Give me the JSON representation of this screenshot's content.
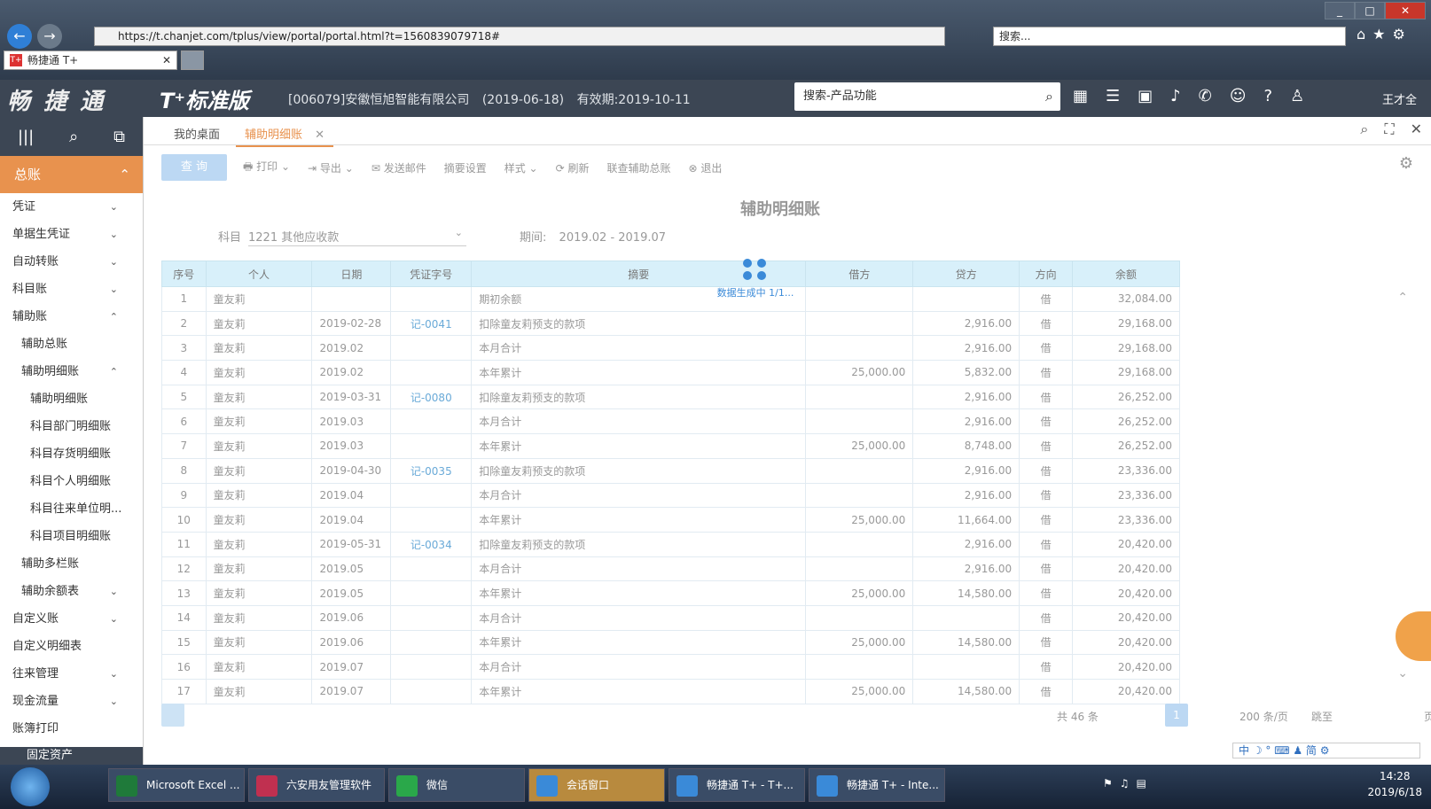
{
  "browser": {
    "url": "https://t.chanjet.com/tplus/view/portal/portal.html?t=1560839079718#",
    "search_placeholder": "搜索...",
    "tab_title": "畅捷通 T+",
    "favicon_text": "T+",
    "window_controls": [
      "_",
      "□",
      "✕"
    ]
  },
  "app": {
    "logo": "畅 捷 通",
    "product": "T⁺标准版",
    "company": "[006079]安徽恒旭智能有限公司",
    "date": "(2019-06-18)",
    "expiry": "有效期:2019-10-11",
    "search_placeholder": "搜索-产品功能",
    "user": "王才全"
  },
  "sidebar": {
    "main": "总账",
    "items": [
      {
        "label": "凭证",
        "chev": "⌄"
      },
      {
        "label": "单据生凭证",
        "chev": "⌄"
      },
      {
        "label": "自动转账",
        "chev": "⌄"
      },
      {
        "label": "科目账",
        "chev": "⌄"
      },
      {
        "label": "辅助账",
        "chev": "⌃"
      },
      {
        "label": "辅助总账",
        "chev": ""
      },
      {
        "label": "辅助明细账",
        "chev": "⌃"
      },
      {
        "label": "辅助明细账",
        "chev": ""
      },
      {
        "label": "科目部门明细账",
        "chev": ""
      },
      {
        "label": "科目存货明细账",
        "chev": ""
      },
      {
        "label": "科目个人明细账",
        "chev": ""
      },
      {
        "label": "科目往来单位明...",
        "chev": ""
      },
      {
        "label": "科目项目明细账",
        "chev": ""
      },
      {
        "label": "辅助多栏账",
        "chev": ""
      },
      {
        "label": "辅助余额表",
        "chev": "⌄"
      },
      {
        "label": "自定义账",
        "chev": "⌄"
      },
      {
        "label": "自定义明细表",
        "chev": ""
      },
      {
        "label": "往来管理",
        "chev": "⌄"
      },
      {
        "label": "现金流量",
        "chev": "⌄"
      },
      {
        "label": "账簿打印",
        "chev": ""
      }
    ],
    "bottom": "固定资产"
  },
  "tabs": {
    "desk": "我的桌面",
    "active": "辅助明细账",
    "close": "✕"
  },
  "toolbar": {
    "query": "查 询",
    "print": "打印",
    "export": "导出",
    "email": "发送邮件",
    "summary": "摘要设置",
    "style": "样式",
    "refresh": "刷新",
    "linked": "联查辅助总账",
    "exit": "退出"
  },
  "report": {
    "title": "辅助明细账",
    "subject_label": "科目",
    "subject_value": "1221 其他应收款",
    "period_label": "期间:",
    "period_value": "2019.02 - 2019.07",
    "loading": "数据生成中 1/1..."
  },
  "table": {
    "headers": [
      "序号",
      "个人",
      "日期",
      "凭证字号",
      "摘要",
      "借方",
      "贷方",
      "方向",
      "余额"
    ],
    "rows": [
      [
        "1",
        "童友莉",
        "",
        "",
        "期初余额",
        "",
        "",
        "借",
        "32,084.00"
      ],
      [
        "2",
        "童友莉",
        "2019-02-28",
        "记-0041",
        "扣除童友莉预支的款项",
        "",
        "2,916.00",
        "借",
        "29,168.00"
      ],
      [
        "3",
        "童友莉",
        "2019.02",
        "",
        "本月合计",
        "",
        "2,916.00",
        "借",
        "29,168.00"
      ],
      [
        "4",
        "童友莉",
        "2019.02",
        "",
        "本年累计",
        "25,000.00",
        "5,832.00",
        "借",
        "29,168.00"
      ],
      [
        "5",
        "童友莉",
        "2019-03-31",
        "记-0080",
        "扣除童友莉预支的款项",
        "",
        "2,916.00",
        "借",
        "26,252.00"
      ],
      [
        "6",
        "童友莉",
        "2019.03",
        "",
        "本月合计",
        "",
        "2,916.00",
        "借",
        "26,252.00"
      ],
      [
        "7",
        "童友莉",
        "2019.03",
        "",
        "本年累计",
        "25,000.00",
        "8,748.00",
        "借",
        "26,252.00"
      ],
      [
        "8",
        "童友莉",
        "2019-04-30",
        "记-0035",
        "扣除童友莉预支的款项",
        "",
        "2,916.00",
        "借",
        "23,336.00"
      ],
      [
        "9",
        "童友莉",
        "2019.04",
        "",
        "本月合计",
        "",
        "2,916.00",
        "借",
        "23,336.00"
      ],
      [
        "10",
        "童友莉",
        "2019.04",
        "",
        "本年累计",
        "25,000.00",
        "11,664.00",
        "借",
        "23,336.00"
      ],
      [
        "11",
        "童友莉",
        "2019-05-31",
        "记-0034",
        "扣除童友莉预支的款项",
        "",
        "2,916.00",
        "借",
        "20,420.00"
      ],
      [
        "12",
        "童友莉",
        "2019.05",
        "",
        "本月合计",
        "",
        "2,916.00",
        "借",
        "20,420.00"
      ],
      [
        "13",
        "童友莉",
        "2019.05",
        "",
        "本年累计",
        "25,000.00",
        "14,580.00",
        "借",
        "20,420.00"
      ],
      [
        "14",
        "童友莉",
        "2019.06",
        "",
        "本月合计",
        "",
        "",
        "借",
        "20,420.00"
      ],
      [
        "15",
        "童友莉",
        "2019.06",
        "",
        "本年累计",
        "25,000.00",
        "14,580.00",
        "借",
        "20,420.00"
      ],
      [
        "16",
        "童友莉",
        "2019.07",
        "",
        "本月合计",
        "",
        "",
        "借",
        "20,420.00"
      ],
      [
        "17",
        "童友莉",
        "2019.07",
        "",
        "本年累计",
        "25,000.00",
        "14,580.00",
        "借",
        "20,420.00"
      ]
    ]
  },
  "pager": {
    "total": "共 46 条",
    "page": "1",
    "size": "200 条/页",
    "jump": "跳至",
    "page_unit": "页"
  },
  "ime": "中 ☽ ° ⌨ ♟ 简 ⚙",
  "taskbar": {
    "items": [
      "Microsoft Excel ...",
      "六安用友管理软件",
      "微信",
      "会话窗口",
      "畅捷通 T+ - T+...",
      "畅捷通 T+ - Inte..."
    ],
    "time": "14:28",
    "date": "2019/6/18"
  },
  "colors": {
    "accent": "#e8924e",
    "header": "#3c4654",
    "link": "#6aaad8",
    "table_head": "#d8f0fa"
  }
}
